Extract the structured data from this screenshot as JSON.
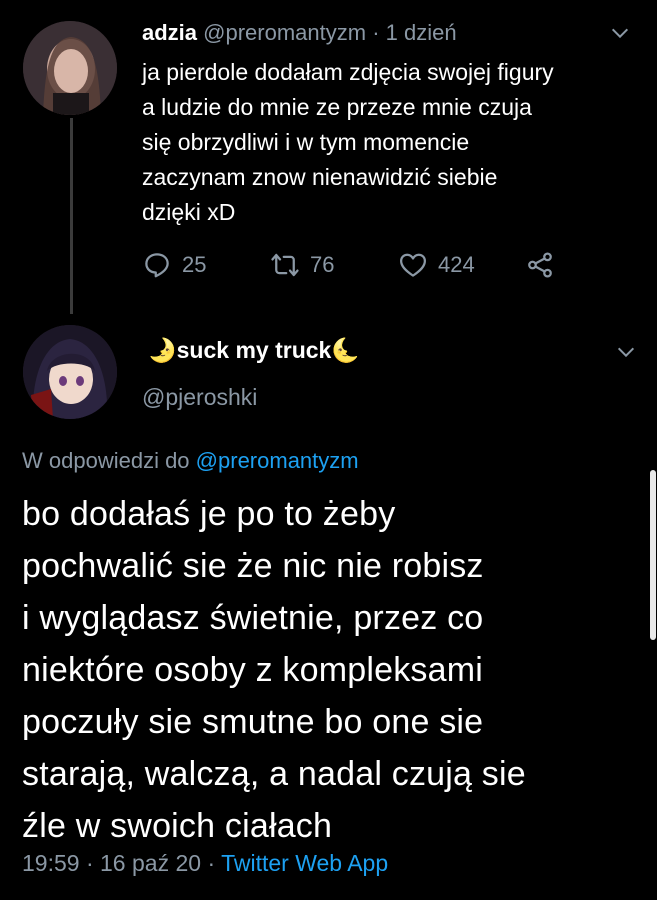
{
  "parent_tweet": {
    "display_name": "adzia",
    "handle": "@preromantyzm",
    "separator": "·",
    "time": "1 dzień",
    "text_lines": [
      "ja pierdole dodałam zdjęcia swojej figury",
      "a ludzie do mnie ze przeze mnie czuja",
      "się obrzydliwi i w tym momencie",
      "zaczynam znow nienawidzić siebie",
      "dzięki xD"
    ],
    "replies": "25",
    "retweets": "76",
    "likes": "424",
    "icons": [
      "reply-icon",
      "retweet-icon",
      "like-icon",
      "share-icon",
      "chevron-down-icon"
    ]
  },
  "reply_tweet": {
    "display_name": "suck my truck",
    "name_emoji_left": "🌛",
    "name_emoji_right": "🌜",
    "handle": "@pjeroshki",
    "reply_prefix": "W odpowiedzi do",
    "reply_to": "@preromantyzm",
    "text_lines": [
      "bo dodałaś je po to żeby",
      "pochwalić sie że nic nie robisz",
      "i wyglądasz świetnie, przez co",
      "niektóre osoby z kompleksami",
      "poczuły sie smutne bo one sie",
      "starają, walczą, a nadal czują sie",
      "źle w swoich ciałach"
    ],
    "time": "19:59",
    "date": "16 paź 20",
    "separator": "·",
    "source": "Twitter Web App"
  },
  "colors": {
    "background": "#000000",
    "text": "#ffffff",
    "muted": "#8b98a5",
    "link": "#1da1f2",
    "thread_line": "#3b3b3b"
  }
}
